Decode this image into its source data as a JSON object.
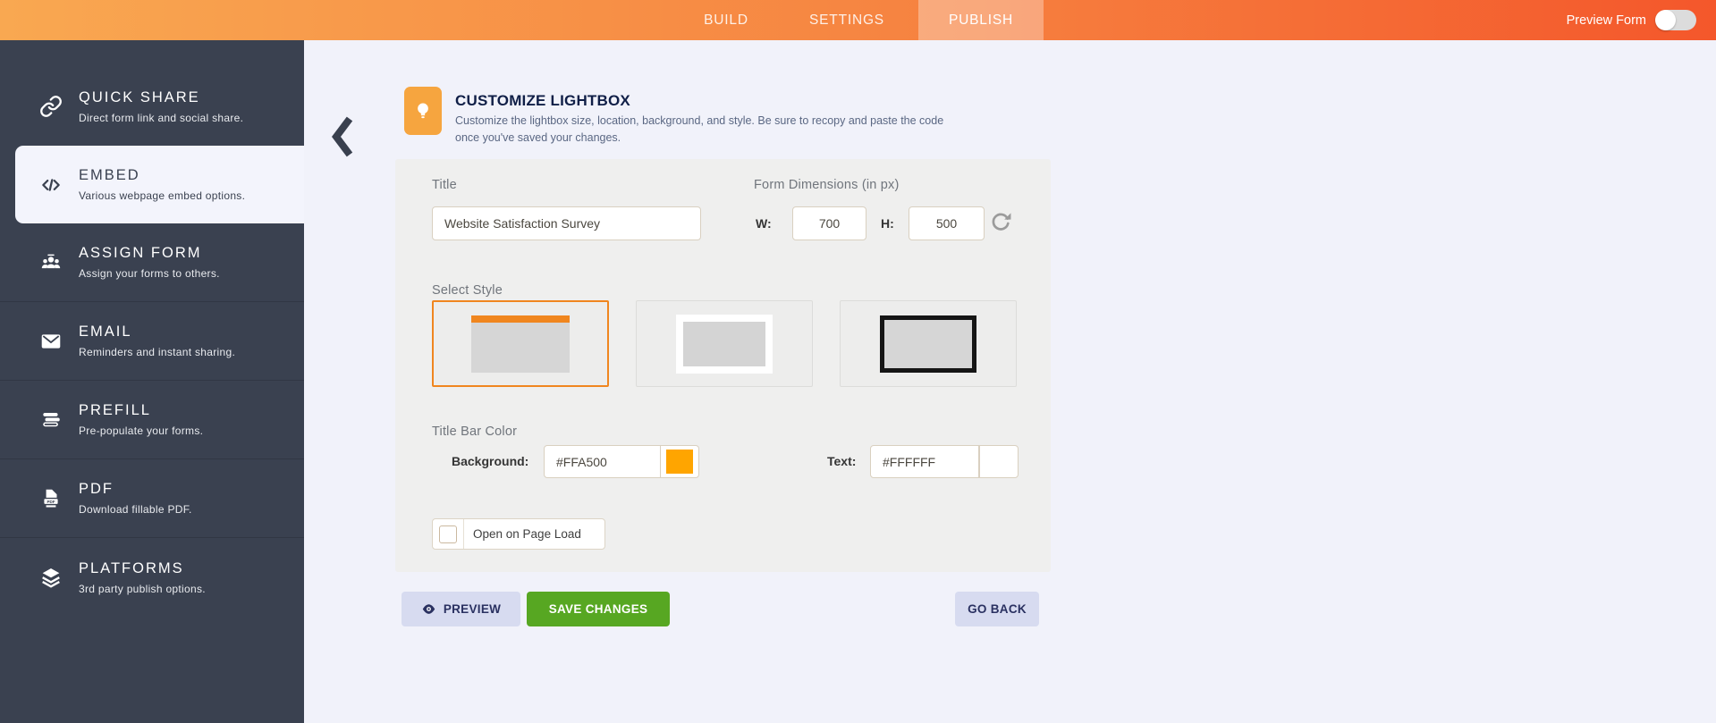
{
  "topbar": {
    "tabs": [
      {
        "label": "BUILD"
      },
      {
        "label": "SETTINGS"
      },
      {
        "label": "PUBLISH",
        "active": true
      }
    ],
    "preview_form_label": "Preview Form",
    "toggle_state": "off"
  },
  "sidebar": {
    "items": [
      {
        "title": "QUICK SHARE",
        "subtitle": "Direct form link and social share.",
        "icon": "link-icon",
        "selected": false
      },
      {
        "title": "EMBED",
        "subtitle": "Various webpage embed options.",
        "icon": "code-icon",
        "selected": true
      },
      {
        "title": "ASSIGN FORM",
        "subtitle": "Assign your forms to others.",
        "icon": "people-icon",
        "selected": false
      },
      {
        "title": "EMAIL",
        "subtitle": "Reminders and instant sharing.",
        "icon": "envelope-icon",
        "selected": false
      },
      {
        "title": "PREFILL",
        "subtitle": "Pre-populate your forms.",
        "icon": "stack-icon",
        "selected": false
      },
      {
        "title": "PDF",
        "subtitle": "Download fillable PDF.",
        "icon": "pdf-icon",
        "selected": false
      },
      {
        "title": "PLATFORMS",
        "subtitle": "3rd party publish options.",
        "icon": "layers-icon",
        "selected": false
      }
    ]
  },
  "header": {
    "title": "CUSTOMIZE LIGHTBOX",
    "description": "Customize the lightbox size, location, background, and style. Be sure to recopy and paste the code once you've saved your changes."
  },
  "form": {
    "title_label": "Title",
    "title_value": "Website Satisfaction Survey",
    "dimensions_label": "Form Dimensions (in px)",
    "width_label": "W:",
    "width_value": "700",
    "height_label": "H:",
    "height_value": "500",
    "select_style_label": "Select Style",
    "styles": [
      {
        "name": "title-bar-style",
        "selected": true
      },
      {
        "name": "white-border-style",
        "selected": false
      },
      {
        "name": "black-border-style",
        "selected": false
      }
    ],
    "title_bar_color_label": "Title Bar Color",
    "background_label": "Background:",
    "background_value": "#FFA500",
    "text_label": "Text:",
    "text_value": "#FFFFFF",
    "open_on_page_load_label": "Open on Page Load",
    "open_on_page_load_checked": false
  },
  "buttons": {
    "preview": "PREVIEW",
    "save": "SAVE CHANGES",
    "go_back": "GO BACK"
  },
  "colors": {
    "accent_orange": "#F6A53F",
    "topbar_left": "#F9A851",
    "topbar_right": "#F4572B",
    "sidebar_bg": "#3A4150",
    "save_green": "#57A722",
    "button_lavender": "#D7DBF0"
  }
}
